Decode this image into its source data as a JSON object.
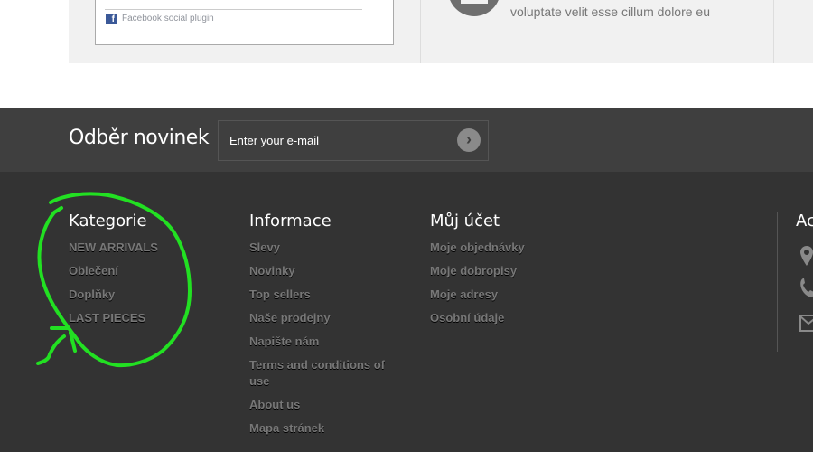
{
  "top": {
    "facebook_plugin": "Facebook social plugin",
    "lorem": "voluptate velit esse cillum dolore eu"
  },
  "newsletter": {
    "title": "Odběr novinek",
    "placeholder": "Enter your e-mail",
    "submit_icon": "chevron-right-circle"
  },
  "columns": [
    {
      "title": "Kategorie",
      "links": [
        "NEW ARRIVALS",
        "Oblečení",
        "Doplňky",
        "LAST PIECES"
      ]
    },
    {
      "title": "Informace",
      "links": [
        "Slevy",
        "Novinky",
        "Top sellers",
        "Naše prodejny",
        "Napište nám",
        "Terms and conditions of use",
        "About us",
        "Mapa stránek"
      ]
    },
    {
      "title": "Můj účet",
      "links": [
        "Moje objednávky",
        "Moje dobropisy",
        "Moje adresy",
        "Osobní údaje"
      ]
    }
  ],
  "contact": {
    "title": "Ac",
    "icons": [
      "map-marker",
      "phone",
      "envelope"
    ]
  },
  "annotation_color": "#22e022"
}
